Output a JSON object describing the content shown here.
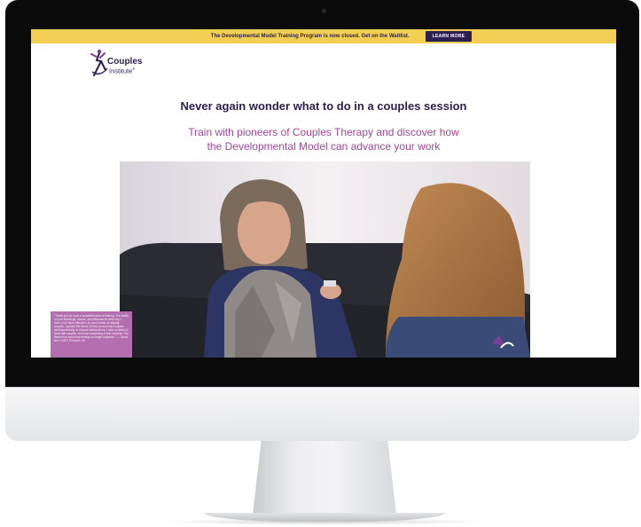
{
  "banner": {
    "text": "The Developmental Model Training Program is now closed. Get on the Waitlist.",
    "button_label": "LEARN MORE"
  },
  "logo": {
    "word1": "Couples",
    "word2": "Institute",
    "mark": "®"
  },
  "headline": "Never again wonder what to do in a couples session",
  "subhead": {
    "line1": "Train with pioneers of Couples Therapy and discover how",
    "line2": "the Developmental Model can advance your work"
  },
  "testimonial": {
    "text": "\"Thank you for such a wonderful year of training. The clarity of your teachings, demos, and discussions were key. I learn a lot! More effective, so much better at helping couples. I gained the sense of how to best help couples developmentally, to choose interventions. I have a clarity of work with couples, for those something in this universe. I've learned so much and feeling no longer hopeless.\" — Donor Ann, LMFT, Prescott, CA"
  },
  "colors": {
    "banner": "#f2cf52",
    "navy": "#2b1f52",
    "magenta": "#a6469b",
    "testimonial": "#b46fb0"
  }
}
